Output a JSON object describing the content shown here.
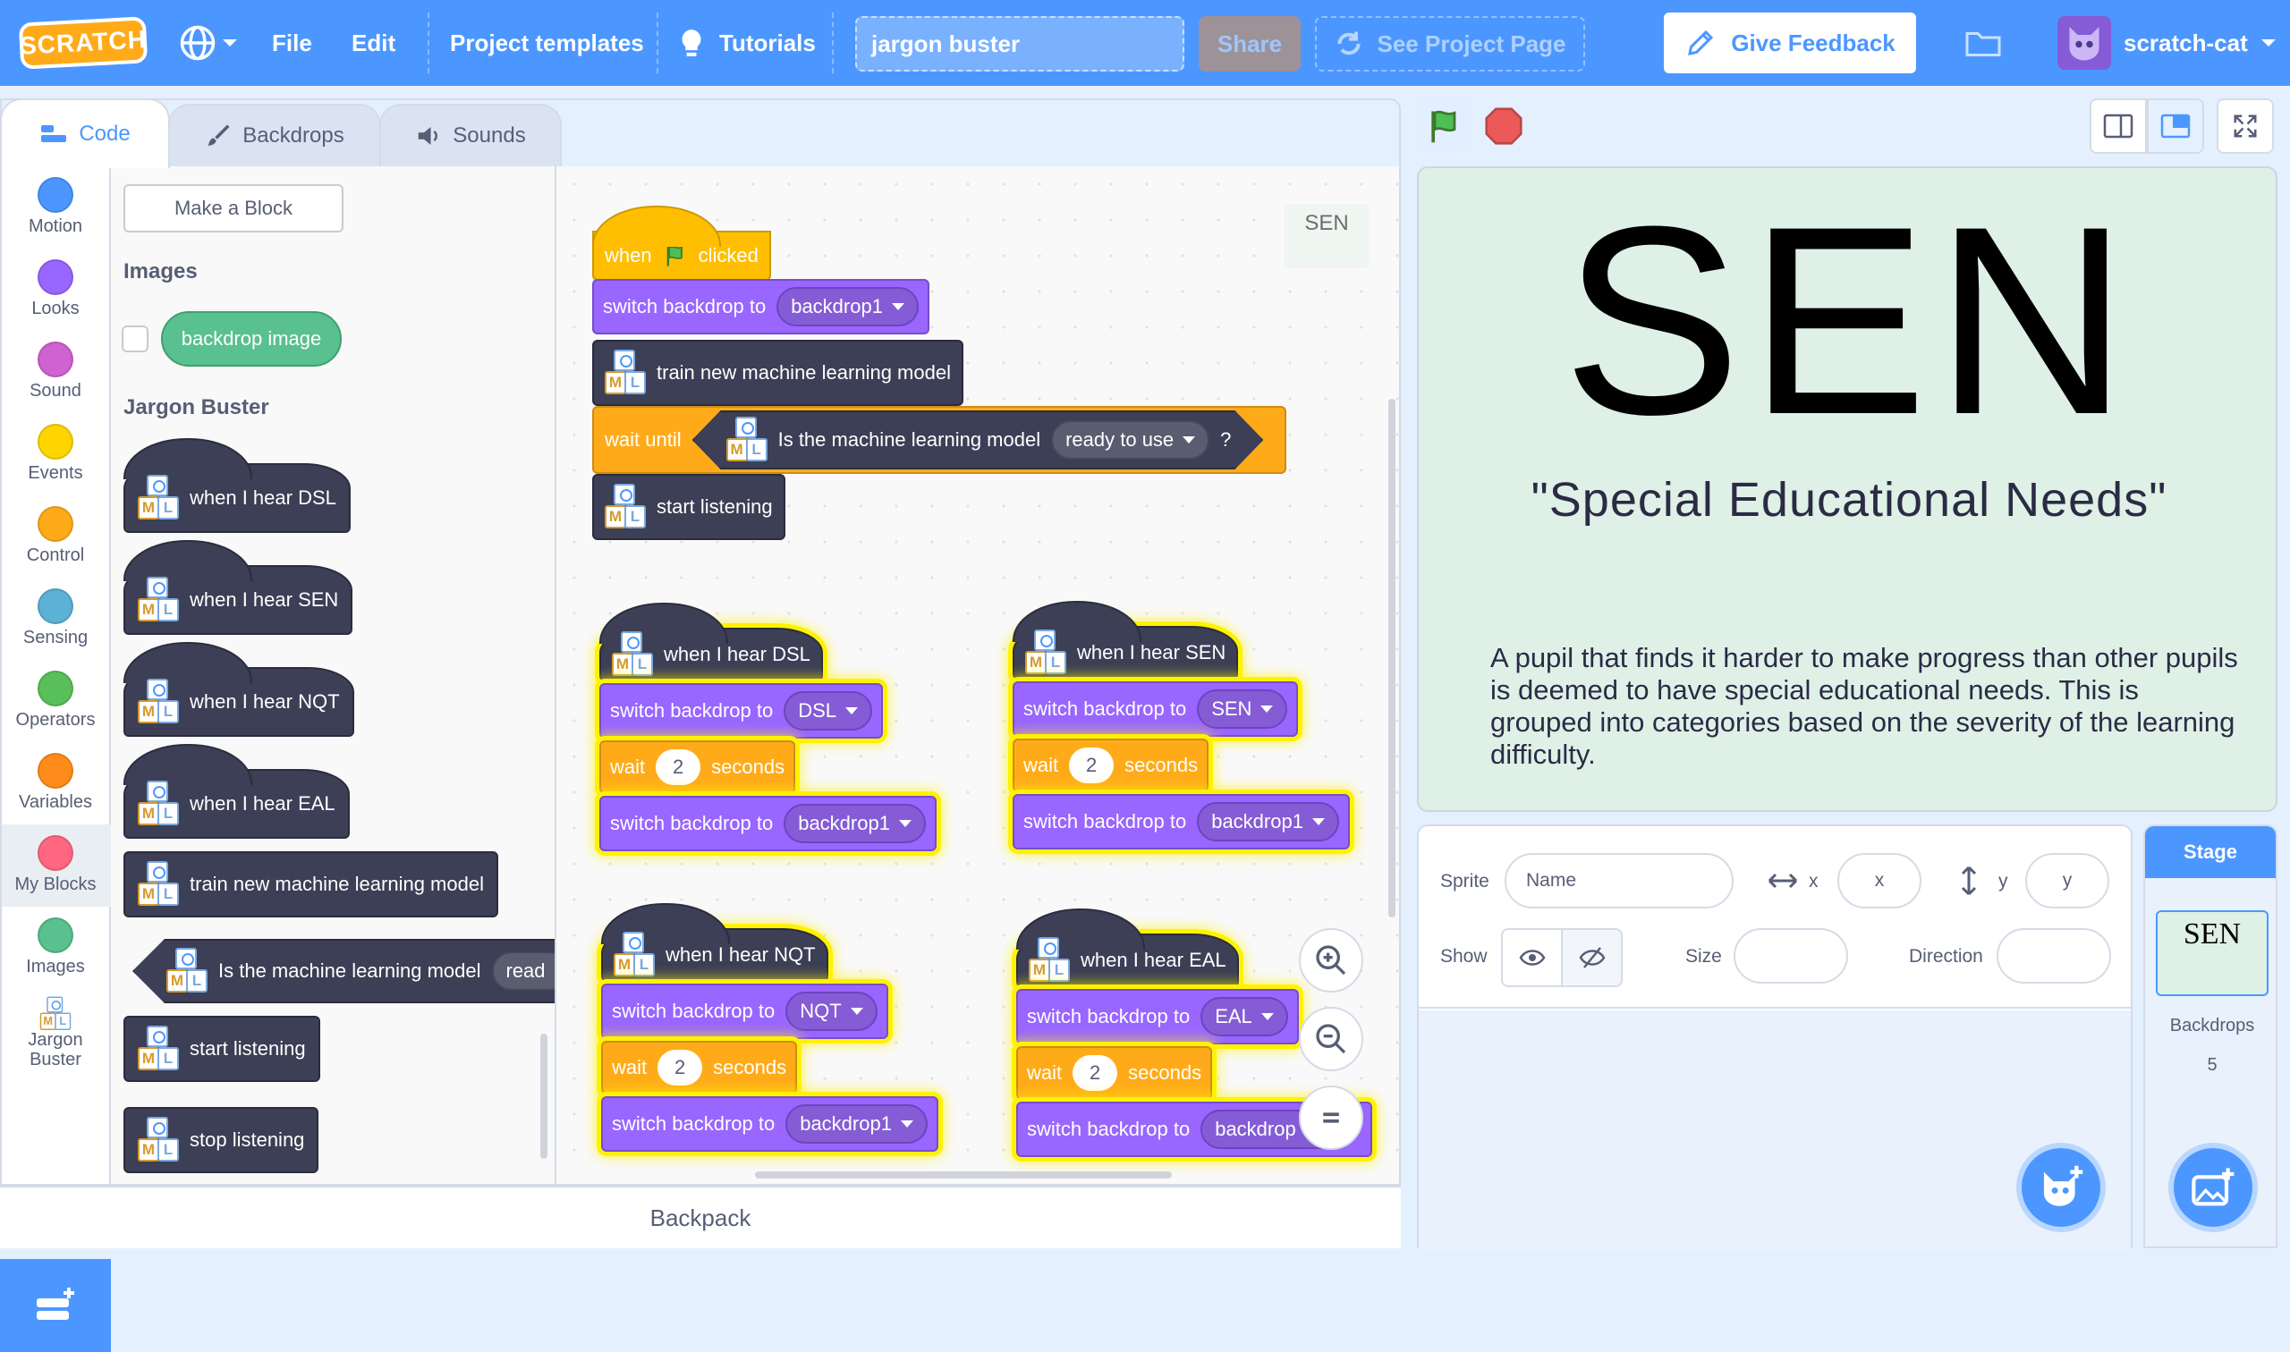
{
  "menu": {
    "logo": "SCRATCH",
    "file": "File",
    "edit": "Edit",
    "templates": "Project templates",
    "tutorials": "Tutorials",
    "title": "jargon buster",
    "share": "Share",
    "see_page": "See Project Page",
    "feedback": "Give Feedback",
    "user": "scratch-cat"
  },
  "tabs": {
    "code": "Code",
    "backdrops": "Backdrops",
    "sounds": "Sounds"
  },
  "categories": [
    {
      "label": "Motion",
      "color": "#4c97ff"
    },
    {
      "label": "Looks",
      "color": "#9966ff"
    },
    {
      "label": "Sound",
      "color": "#cf63cf"
    },
    {
      "label": "Events",
      "color": "#ffd500"
    },
    {
      "label": "Control",
      "color": "#ffab19"
    },
    {
      "label": "Sensing",
      "color": "#5cb1d6"
    },
    {
      "label": "Operators",
      "color": "#59c059"
    },
    {
      "label": "Variables",
      "color": "#ff8c1a"
    },
    {
      "label": "My Blocks",
      "color": "#ff6680"
    },
    {
      "label": "Images",
      "color": "#59c08f"
    },
    {
      "label": "Jargon Buster",
      "color": "#4c97ff"
    }
  ],
  "flyout": {
    "make_block": "Make a Block",
    "images_head": "Images",
    "backdrop_image": "backdrop image",
    "jargon_head": "Jargon Buster",
    "blocks": [
      "when I hear DSL",
      "when I hear SEN",
      "when I hear NQT",
      "when I hear EAL",
      "train new machine learning model",
      "Is the machine learning model",
      "start listening",
      "stop listening"
    ],
    "ready_truncated": "read"
  },
  "script": {
    "when": "when",
    "clicked": "clicked",
    "switch_backdrop": "switch backdrop to",
    "backdrop1": "backdrop1",
    "train": "train new machine learning model",
    "wait_until": "wait until",
    "is_model": "Is the machine learning model",
    "ready": "ready to use",
    "q": "?",
    "start_listening": "start listening",
    "wait": "wait",
    "seconds": "seconds",
    "two": "2",
    "hear_dsl": "when I hear DSL",
    "hear_sen": "when I hear SEN",
    "hear_nqt": "when I hear NQT",
    "hear_eal": "when I hear EAL",
    "dsl": "DSL",
    "sen": "SEN",
    "nqt": "NQT",
    "eal": "EAL",
    "backdrop_trunc": "backdrop",
    "thumb": "SEN"
  },
  "backpack": "Backpack",
  "stage": {
    "big": "SEN",
    "sub": "\"Special Educational Needs\"",
    "desc": "A pupil that finds it harder to make progress than other pupils is deemed to have special educational needs. This is grouped into categories based on the severity of the learning difficulty."
  },
  "sprite": {
    "label": "Sprite",
    "name_ph": "Name",
    "x_label": "x",
    "x_ph": "x",
    "y_label": "y",
    "y_ph": "y",
    "show": "Show",
    "size": "Size",
    "direction": "Direction"
  },
  "stage_panel": {
    "head": "Stage",
    "thumb": "SEN",
    "backdrops_label": "Backdrops",
    "backdrops_count": "5"
  },
  "colors": {
    "accent": "#4c97ff",
    "looks": "#9966ff",
    "control": "#ffab19",
    "events": "#ffbf00",
    "ml": "#3c3f55"
  }
}
